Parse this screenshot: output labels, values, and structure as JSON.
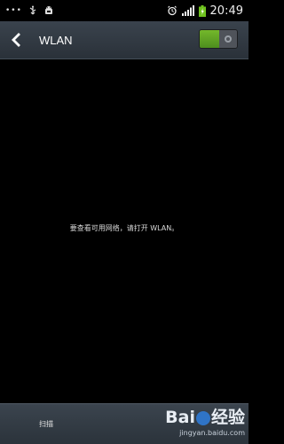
{
  "status_bar": {
    "time": "20:49",
    "icons": [
      "more-dots-icon",
      "usb-icon",
      "android-debug-icon",
      "alarm-icon",
      "signal-icon",
      "battery-charging-icon"
    ]
  },
  "action_bar": {
    "title": "WLAN",
    "toggle_state": "on"
  },
  "content": {
    "message": "要查看可用网络，请打开 WLAN。"
  },
  "bottom_bar": {
    "scan_label": "扫描"
  },
  "watermark": {
    "logo_text_1": "Bai",
    "logo_text_2": "经验",
    "url": "jingyan.baidu.com"
  },
  "colors": {
    "toggle_on": "#5ea524",
    "bar_bg": "#333b44",
    "brand_blue": "#2f74c7"
  }
}
